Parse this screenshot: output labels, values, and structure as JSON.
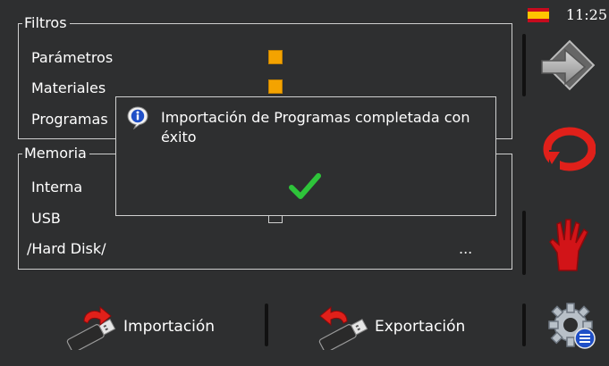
{
  "status": {
    "language_flag": "spain-flag-icon",
    "time": "11:25"
  },
  "filters": {
    "title": "Filtros",
    "items": [
      {
        "label": "Parámetros",
        "checked": true
      },
      {
        "label": "Materiales",
        "checked": true
      },
      {
        "label": "Programas"
      }
    ]
  },
  "memory": {
    "title": "Memoria",
    "items": [
      {
        "label": "Interna"
      },
      {
        "label": "USB",
        "checked": false
      }
    ],
    "path": "/Hard Disk/",
    "browse_label": "..."
  },
  "dialog": {
    "icon": "info-icon",
    "message": "Importación de Programas completada con éxito",
    "confirm_icon": "checkmark-icon"
  },
  "toolbar": {
    "import_label": "Importación",
    "export_label": "Exportación"
  },
  "side_buttons": [
    "enter-arrow-icon",
    "refresh-icon",
    "stop-hand-icon",
    "settings-gear-icon"
  ],
  "colors": {
    "background": "#2e2f30",
    "checkbox_checked": "#f4a300",
    "confirm_green": "#2ec43a",
    "refresh_red": "#e0201a"
  }
}
